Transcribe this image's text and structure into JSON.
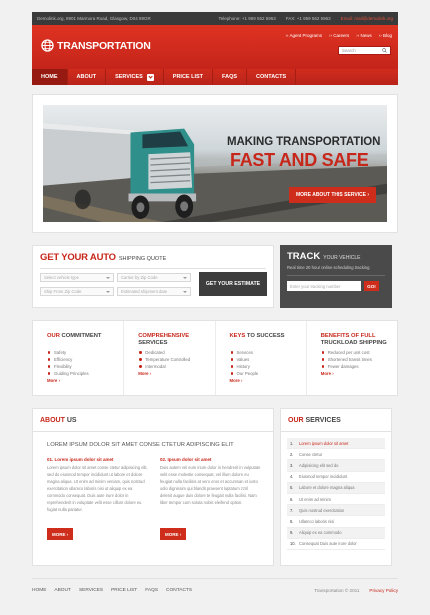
{
  "topbar": {
    "address": "Demolink.org, 8901 Marmora Road, Glasgow, D04 89GR",
    "telephone": "Telephone: +1 959 552 5963",
    "fax": "FAX: +1 959 552 5963",
    "email": "Email: mail@demolink.org"
  },
  "header": {
    "logo_text": "TRANSPORTATION",
    "links": [
      "Agent Programs",
      "Careers",
      "News",
      "Blog"
    ],
    "search_placeholder": "Search"
  },
  "nav": {
    "items": [
      "HOME",
      "ABOUT",
      "SERVICES",
      "PRICE LIST",
      "FAQS",
      "CONTACTS"
    ],
    "active": "HOME"
  },
  "hero": {
    "line1": "MAKING TRANSPORTATION",
    "line2": "FAST AND SAFE",
    "button": "MORE ABOUT THIS SERVICE ›"
  },
  "quote": {
    "title_big": "GET YOUR AUTO",
    "title_small": "SHIPPING QUOTE",
    "fields": [
      "Select vehicle type",
      "Carrier by Zip Code",
      "Ship From Zip Code",
      "Estimated shipment date"
    ],
    "button": "GET YOUR ESTIMATE"
  },
  "track": {
    "title_big": "TRACK",
    "title_small": "YOUR VEHICLE",
    "desc": "Real time 20 hour online scheduling tracking",
    "placeholder": "Enter your tracking number",
    "button": "GO!"
  },
  "features": [
    {
      "title_hl": "OUR",
      "title_rest": " COMMITMENT",
      "items": [
        "Safety",
        "Efficiency",
        "Flexibility",
        "Guiding Principles"
      ],
      "more": "More ›"
    },
    {
      "title_hl": "COMPREHENSIVE",
      "title_rest": " SERVICES",
      "items": [
        "Dedicated",
        "Temperature Controlled",
        "Intermodal"
      ],
      "more": "More ›"
    },
    {
      "title_hl": "KEYS",
      "title_rest": " TO SUCCESS",
      "items": [
        "Services",
        "Values",
        "History",
        "Our People"
      ],
      "more": "More ›"
    },
    {
      "title_hl": "BENEFITS OF FULL",
      "title_rest": " TRUCKLOAD SHIPPING",
      "items": [
        "Reduced per unit cost",
        "Shortened transit times",
        "Fewer damages"
      ],
      "more": "More ›"
    }
  ],
  "about": {
    "title_hl": "ABOUT",
    "title_rest": " US",
    "lead": "LOREM IPSUM DOLOR SIT AMET CONSE CTETUR ADIPISCING ELIT",
    "col1": {
      "heading": "01. Lorem ipsum dolor sit amet",
      "text": "Lorem ipsum dolor sit amet conse ctetur adipisicing elit, sed do eiusmod tempor incididunt ut labore et dolore magna aliqua. Ut enim ad minim veniam, quis nostrud exercitation ullamco laboris nisi ut aliquip ex ea commodo consequat. Duis aute irure dolor in reprehenderit in voluptate velit esse cillum dolore eu fugiat nulla pariatur.",
      "more": "MORE ›"
    },
    "col2": {
      "heading": "02. Ipsum dolor sit amet",
      "text": "Duis autem vel eum iriure dolor in hendrerit in vulputate velit esse molestie consequat, vel illum dolore eu feugiat nulla facilisis at vero eros et accumsan et iusto odio dignissim qui blandit praesent luptatum zzril delenit augue duis dolore te feugait nulla facilisi. Nam liber tempor cum soluta nobis eleifend option.",
      "more": "MORE ›"
    }
  },
  "services": {
    "title_hl": "OUR",
    "title_rest": " SERVICES",
    "items": [
      "Lorem ipsum dolor sit amet",
      "Conse ctetur",
      "Adipisicing elit sed do",
      "Eiusmod tempor incididunt",
      "Labore et dolore magna aliqua",
      "Ut enim ad minim",
      "Quis nostrud exercitation",
      "Ullamco laboris nisi",
      "Aliquip ex ea commodo",
      "Consequat Duis aute irure dolor"
    ]
  },
  "footer": {
    "nav": [
      "HOME",
      "ABOUT",
      "SERVICES",
      "PRICE LIST",
      "FAQS",
      "CONTACTS"
    ],
    "copyright": "Transportation © 2011",
    "privacy": "Privacy Policy"
  },
  "colors": {
    "brand_red": "#c7261a",
    "dark": "#3a3a3a"
  }
}
